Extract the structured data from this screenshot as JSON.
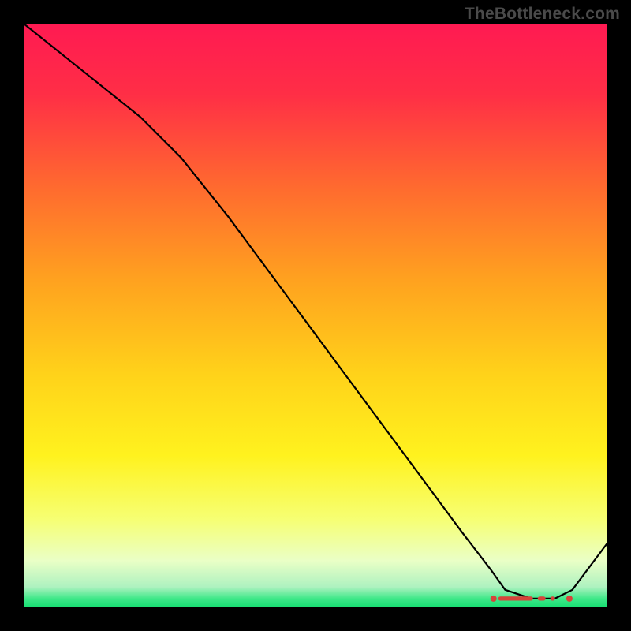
{
  "watermark": "TheBottleneck.com",
  "chart_data": {
    "type": "line",
    "title": "",
    "xlabel": "",
    "ylabel": "",
    "xlim": [
      0,
      100
    ],
    "ylim": [
      0,
      100
    ],
    "grid": false,
    "legend": false,
    "note": "Axis values are in relative percent of the plot area; x and y values are estimated from pixel positions since the original image has no tick labels.",
    "series": [
      {
        "name": "bottleneck-curve",
        "color": "#000000",
        "x": [
          0,
          10,
          20,
          27,
          35,
          45,
          55,
          65,
          75,
          80,
          82.5,
          87,
          91,
          94,
          100
        ],
        "y": [
          100,
          92,
          84,
          77,
          67,
          53.5,
          40,
          26.5,
          13,
          6.5,
          3,
          1.5,
          1.5,
          3,
          11
        ]
      }
    ],
    "optimal_range_x": [
      80.5,
      93.5
    ],
    "background_gradient": {
      "stops": [
        {
          "pos": 0.0,
          "color": "#ff1a52"
        },
        {
          "pos": 0.12,
          "color": "#ff2e46"
        },
        {
          "pos": 0.28,
          "color": "#ff6a2f"
        },
        {
          "pos": 0.44,
          "color": "#ffa21f"
        },
        {
          "pos": 0.6,
          "color": "#ffd21a"
        },
        {
          "pos": 0.74,
          "color": "#fff21e"
        },
        {
          "pos": 0.85,
          "color": "#f6ff74"
        },
        {
          "pos": 0.92,
          "color": "#eaffc6"
        },
        {
          "pos": 0.965,
          "color": "#aef2c0"
        },
        {
          "pos": 0.985,
          "color": "#3fe889"
        },
        {
          "pos": 1.0,
          "color": "#16df72"
        }
      ]
    }
  }
}
